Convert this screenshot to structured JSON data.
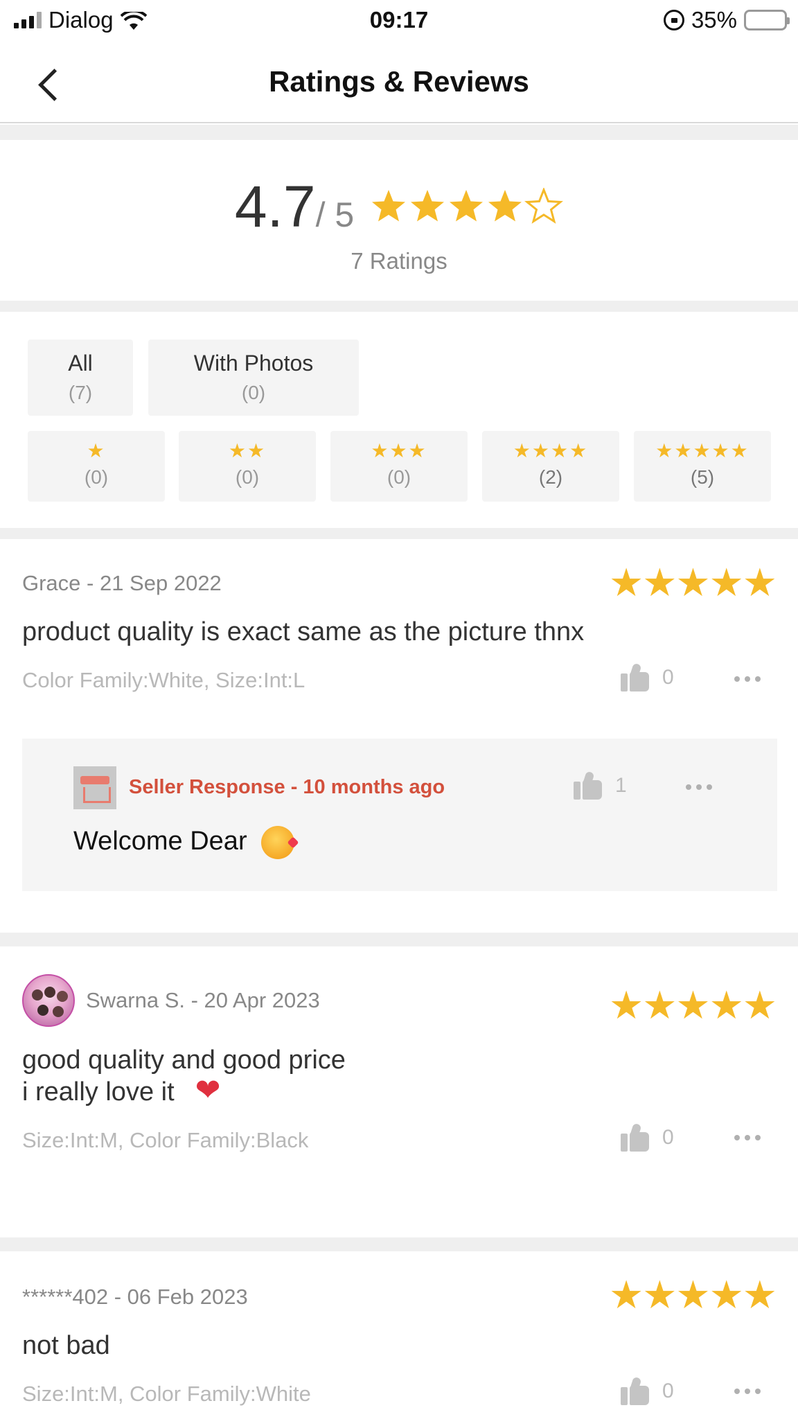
{
  "status_bar": {
    "carrier": "Dialog",
    "time": "09:17",
    "battery": "35%",
    "battery_level": 0.35
  },
  "nav": {
    "title": "Ratings & Reviews"
  },
  "summary": {
    "score": "4.7",
    "max": "/ 5",
    "stars": 4.7,
    "ratings_text": "7 Ratings"
  },
  "filters": {
    "all": {
      "label": "All",
      "count": "(7)"
    },
    "photos": {
      "label": "With Photos",
      "count": "(0)"
    },
    "stars": [
      {
        "stars": "★",
        "count": "(0)"
      },
      {
        "stars": "★★",
        "count": "(0)"
      },
      {
        "stars": "★★★",
        "count": "(0)"
      },
      {
        "stars": "★★★★",
        "count": "(2)"
      },
      {
        "stars": "★★★★★",
        "count": "(5)"
      }
    ]
  },
  "reviews": [
    {
      "author_date": "Grace - 21 Sep 2022",
      "stars": "★★★★★",
      "text": "product quality is exact same as the picture thnx",
      "sku": "Color Family:White, Size:Int:L",
      "likes": "0",
      "seller_response": {
        "title": "Seller Response - 10  months ago",
        "likes": "1",
        "text": "Welcome Dear",
        "emoji": "smiling-face-with-hearts"
      }
    },
    {
      "author_date": "Swarna S. - 20 Apr 2023",
      "stars": "★★★★★",
      "text_line1": "good quality and good price",
      "text_line2": "i really love it",
      "emoji": "heart",
      "sku": "Size:Int:M, Color Family:Black",
      "likes": "0"
    },
    {
      "author_date": "******402 - 06 Feb 2023",
      "stars": "★★★★★",
      "text": "not bad",
      "sku": "Size:Int:M, Color Family:White",
      "likes": "0"
    }
  ],
  "colors": {
    "star": "#f5b928",
    "seller_accent": "#d3503c",
    "divider": "#efefef"
  }
}
